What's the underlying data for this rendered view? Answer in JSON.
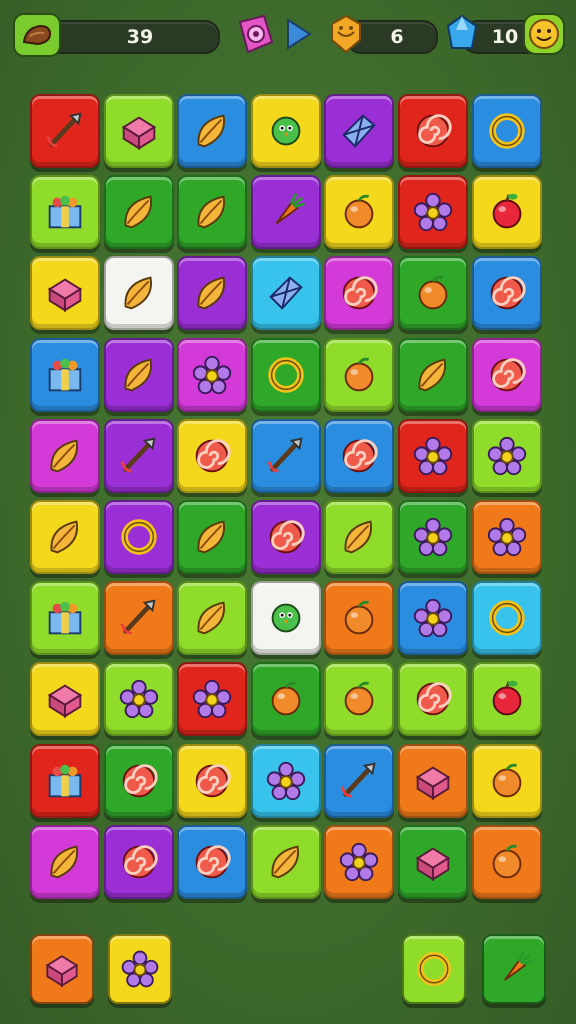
{
  "hud": {
    "left_counter": {
      "value": "39",
      "icon": "chocolate-icon",
      "color": "#7acc2e"
    },
    "center_icon": "pink-gem-icon",
    "play_icon": "play-arrow-icon",
    "coin_counter": {
      "value": "6",
      "icon": "gold-coin-icon"
    },
    "gem_counter": {
      "value": "10",
      "icon": "blue-gem-icon"
    },
    "smiley_icon": "smiley-icon"
  },
  "colors": {
    "red": "#e0261c",
    "lime": "#8fdc2a",
    "blue": "#2a8de0",
    "yellow": "#f3d81c",
    "purple": "#9a2fd6",
    "green": "#2fa82a",
    "orange": "#f07a1a",
    "magenta": "#d43ad8",
    "cyan": "#37c3ec",
    "white": "#f4f4f0"
  },
  "board": {
    "rows": [
      [
        [
          "red",
          "arrow"
        ],
        [
          "lime",
          "box"
        ],
        [
          "blue",
          "leaf"
        ],
        [
          "yellow",
          "bird"
        ],
        [
          "purple",
          "kite"
        ],
        [
          "red",
          "swirl"
        ],
        [
          "blue",
          "ring"
        ]
      ],
      [
        [
          "lime",
          "giftbox"
        ],
        [
          "green",
          "leaf"
        ],
        [
          "green",
          "leaf"
        ],
        [
          "purple",
          "carrot"
        ],
        [
          "yellow",
          "berry"
        ],
        [
          "red",
          "flower"
        ],
        [
          "yellow",
          "apple"
        ]
      ],
      [
        [
          "yellow",
          "box"
        ],
        [
          "white",
          "leaf"
        ],
        [
          "purple",
          "leaf"
        ],
        [
          "cyan",
          "kite"
        ],
        [
          "magenta",
          "swirl"
        ],
        [
          "green",
          "berry"
        ],
        [
          "blue",
          "swirl"
        ]
      ],
      [
        [
          "blue",
          "giftbox"
        ],
        [
          "purple",
          "leaf"
        ],
        [
          "magenta",
          "flower"
        ],
        [
          "green",
          "ring"
        ],
        [
          "lime",
          "berry"
        ],
        [
          "green",
          "leaf"
        ],
        [
          "magenta",
          "swirl"
        ]
      ],
      [
        [
          "magenta",
          "leaf"
        ],
        [
          "purple",
          "arrow"
        ],
        [
          "yellow",
          "swirl"
        ],
        [
          "blue",
          "arrow"
        ],
        [
          "blue",
          "swirl"
        ],
        [
          "red",
          "flower"
        ],
        [
          "lime",
          "flower"
        ]
      ],
      [
        [
          "yellow",
          "leaf"
        ],
        [
          "purple",
          "ring"
        ],
        [
          "green",
          "leaf"
        ],
        [
          "purple",
          "swirl"
        ],
        [
          "lime",
          "leaf"
        ],
        [
          "green",
          "flower"
        ],
        [
          "orange",
          "flower"
        ]
      ],
      [
        [
          "lime",
          "giftbox"
        ],
        [
          "orange",
          "arrow"
        ],
        [
          "lime",
          "leaf"
        ],
        [
          "white",
          "bird"
        ],
        [
          "orange",
          "berry"
        ],
        [
          "blue",
          "flower"
        ],
        [
          "cyan",
          "ring"
        ]
      ],
      [
        [
          "yellow",
          "box"
        ],
        [
          "lime",
          "flower"
        ],
        [
          "red",
          "flower"
        ],
        [
          "green",
          "berry"
        ],
        [
          "lime",
          "berry"
        ],
        [
          "lime",
          "swirl"
        ],
        [
          "lime",
          "apple"
        ]
      ],
      [
        [
          "red",
          "giftbox"
        ],
        [
          "green",
          "swirl"
        ],
        [
          "yellow",
          "swirl"
        ],
        [
          "cyan",
          "flower"
        ],
        [
          "blue",
          "arrow"
        ],
        [
          "orange",
          "box"
        ],
        [
          "yellow",
          "berry"
        ]
      ],
      [
        [
          "magenta",
          "leaf"
        ],
        [
          "purple",
          "swirl"
        ],
        [
          "blue",
          "swirl"
        ],
        [
          "lime",
          "leaf"
        ],
        [
          "orange",
          "flower"
        ],
        [
          "green",
          "box"
        ],
        [
          "orange",
          "berry"
        ]
      ]
    ]
  },
  "boosters": [
    {
      "name": "booster-eraser",
      "color": "orange",
      "icon": "box"
    },
    {
      "name": "booster-bouquet",
      "color": "yellow",
      "icon": "flower"
    },
    {
      "name": "booster-shuffle",
      "color": "lime",
      "icon": "ring"
    },
    {
      "name": "booster-carrot",
      "color": "green",
      "icon": "carrot"
    }
  ]
}
